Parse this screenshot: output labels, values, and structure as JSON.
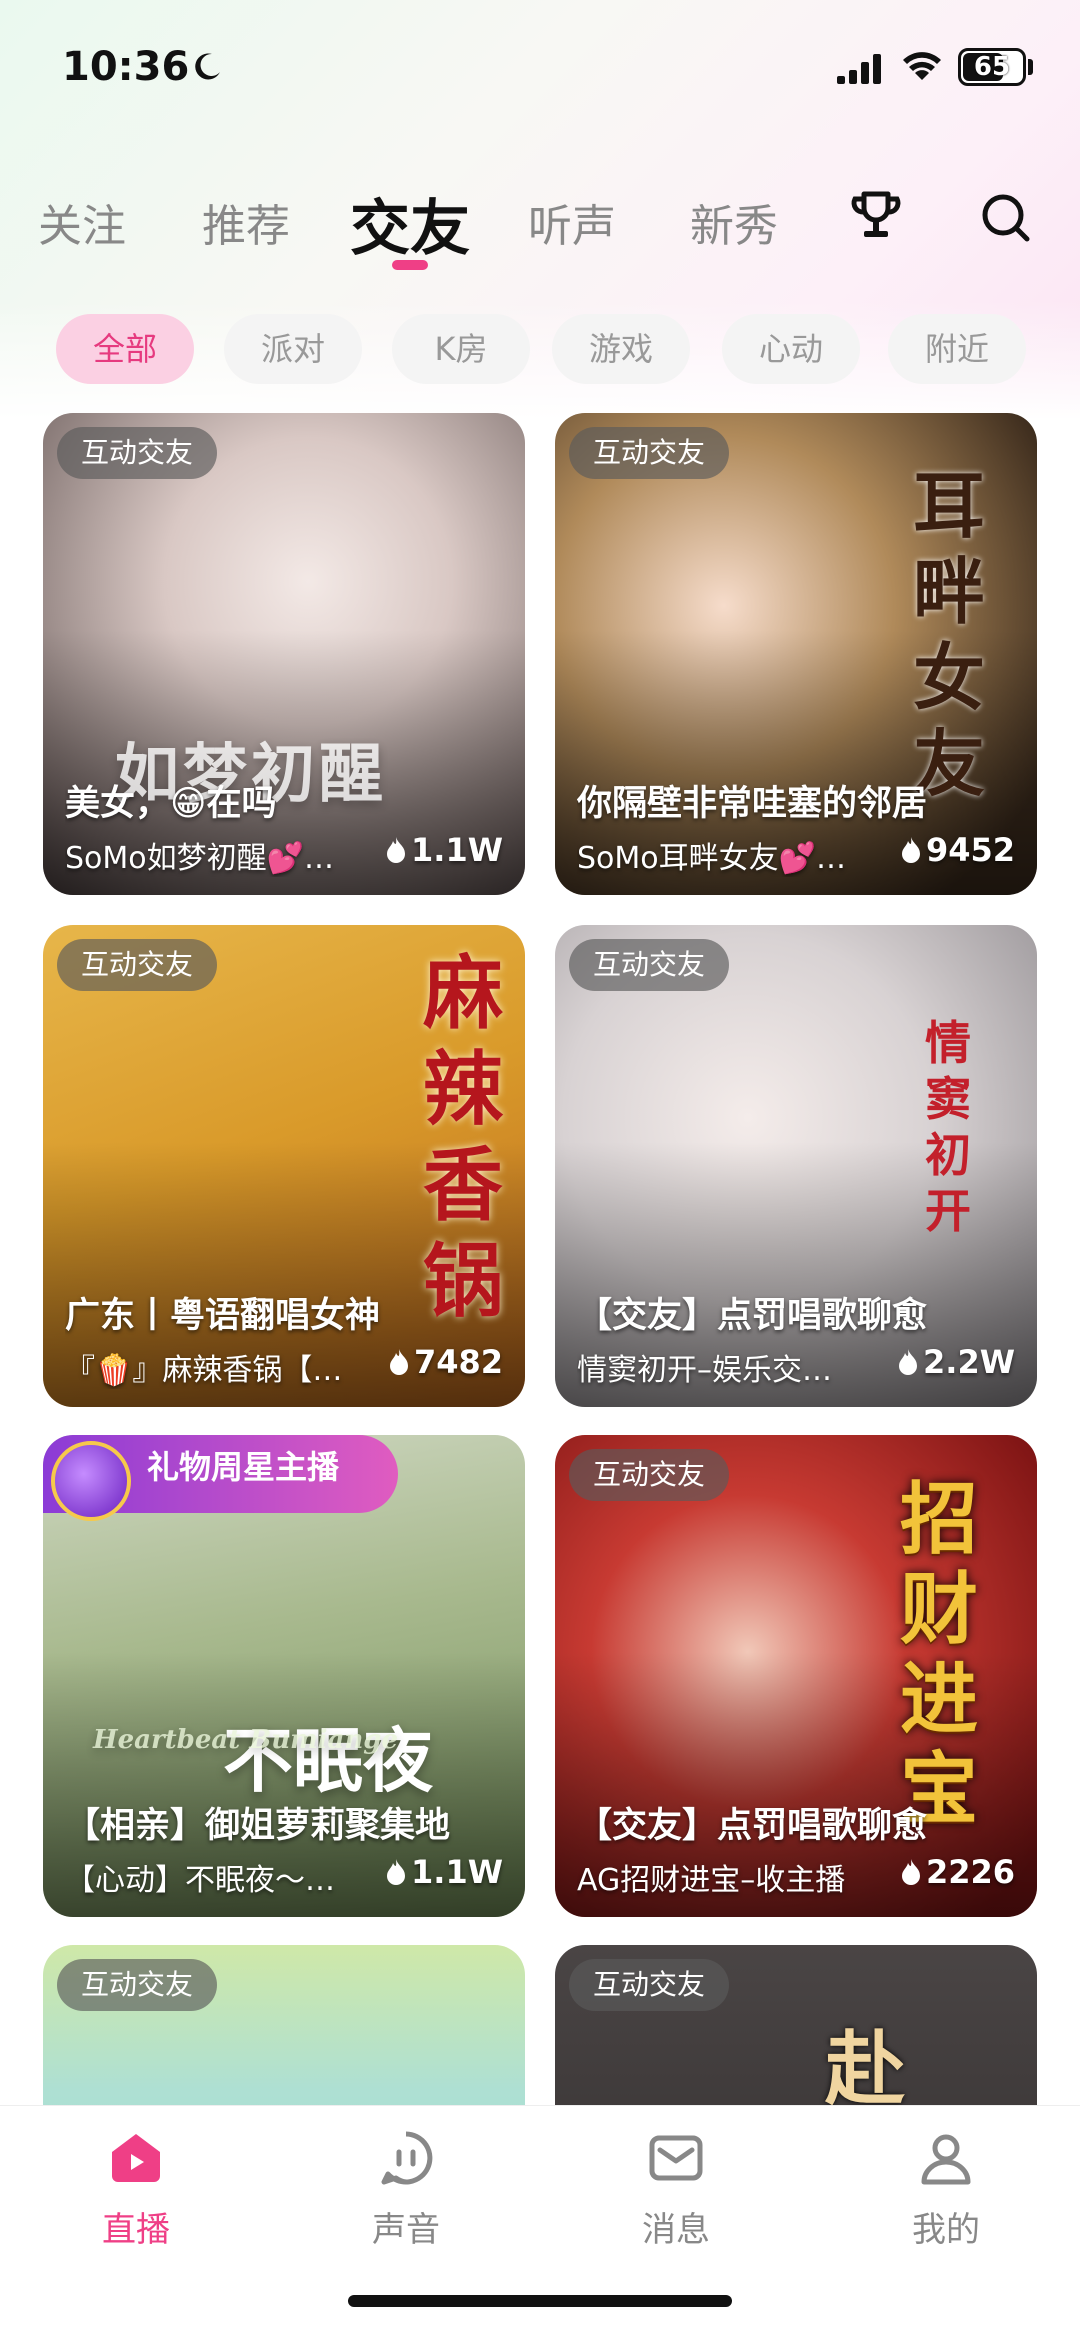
{
  "status": {
    "time": "10:36",
    "battery": "65"
  },
  "main_tabs": [
    {
      "label": "关注"
    },
    {
      "label": "推荐"
    },
    {
      "label": "交友"
    },
    {
      "label": "听声"
    },
    {
      "label": "新秀"
    }
  ],
  "active_main_tab": "交友",
  "chips": [
    {
      "label": "全部"
    },
    {
      "label": "派对"
    },
    {
      "label": "K房"
    },
    {
      "label": "游戏"
    },
    {
      "label": "心动"
    },
    {
      "label": "附近"
    }
  ],
  "active_chip": "全部",
  "cards": [
    {
      "tag": "互动交友",
      "title": "美女，😁在吗",
      "subtitle": "SoMo如梦初醒💕…",
      "heat": "1.1W",
      "deco": "如梦初醒"
    },
    {
      "tag": "互动交友",
      "title": "你隔壁非常哇塞的邻居",
      "subtitle": "SoMo耳畔女友💕…",
      "heat": "9452",
      "deco": "耳畔女友"
    },
    {
      "tag": "互动交友",
      "title": "广东丨粤语翻唱女神",
      "subtitle": "『🍿』麻辣香锅【…",
      "heat": "7482",
      "deco": "麻辣香锅"
    },
    {
      "tag": "互动交友",
      "title": "【交友】点罚唱歌聊愈",
      "subtitle": "情窦初开–娱乐交…",
      "heat": "2.2W",
      "deco": "情窦初开"
    },
    {
      "tag": "礼物周星主播",
      "title": "【相亲】御姐萝莉聚集地",
      "subtitle": "【心动】不眠夜～…",
      "heat": "1.1W",
      "deco": "不眠夜",
      "deco_sub": "Heartbeat Bumiange"
    },
    {
      "tag": "互动交友",
      "title": "【交友】点罚唱歌聊愈",
      "subtitle": "AG招财进宝–收主播",
      "heat": "2226",
      "deco": "招财进宝"
    },
    {
      "tag": "互动交友"
    },
    {
      "tag": "互动交友",
      "deco": "赴"
    }
  ],
  "tabbar": [
    {
      "label": "直播",
      "icon": "live-home-icon"
    },
    {
      "label": "声音",
      "icon": "voice-icon"
    },
    {
      "label": "消息",
      "icon": "message-icon"
    },
    {
      "label": "我的",
      "icon": "profile-icon"
    }
  ],
  "active_tabbar": "直播",
  "colors": {
    "accent": "#ef3f86",
    "chip_active_bg": "#fbd0e3"
  }
}
